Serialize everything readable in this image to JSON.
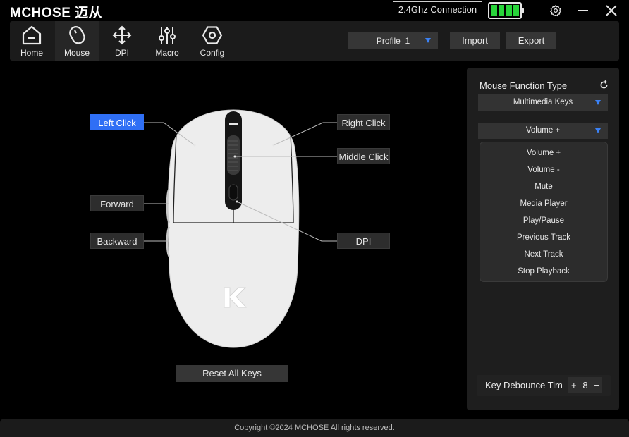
{
  "app": {
    "logo": "MCHOSE 迈从"
  },
  "titlebar": {
    "connection": "2.4Ghz Connection"
  },
  "nav": {
    "items": [
      {
        "label": "Home",
        "icon": "home-icon"
      },
      {
        "label": "Mouse",
        "icon": "mouse-icon"
      },
      {
        "label": "DPI",
        "icon": "move-icon"
      },
      {
        "label": "Macro",
        "icon": "sliders-icon"
      },
      {
        "label": "Config",
        "icon": "hexagon-icon"
      }
    ],
    "active": "Mouse"
  },
  "toolbar": {
    "profile_label": "Profile",
    "profile_value": "1",
    "import_label": "Import",
    "export_label": "Export"
  },
  "mouse_keys": {
    "left_click": "Left Click",
    "right_click": "Right Click",
    "middle_click": "Middle Click",
    "forward": "Forward",
    "backward": "Backward",
    "dpi": "DPI",
    "reset_label": "Reset All Keys"
  },
  "panel": {
    "title": "Mouse Function Type",
    "function_type": "Multimedia Keys",
    "selected_key": "Volume +",
    "options": [
      "Volume +",
      "Volume -",
      "Mute",
      "Media Player",
      "Play/Pause",
      "Previous Track",
      "Next Track",
      "Stop Playback"
    ],
    "debounce_label": "Key Debounce Tim",
    "debounce_value": "8",
    "plus": "+",
    "minus": "−"
  },
  "footer": {
    "copyright": "Copyright ©2024 MCHOSE All rights reserved."
  },
  "colors": {
    "accent": "#2f6ff5",
    "battery": "#28d43a"
  }
}
